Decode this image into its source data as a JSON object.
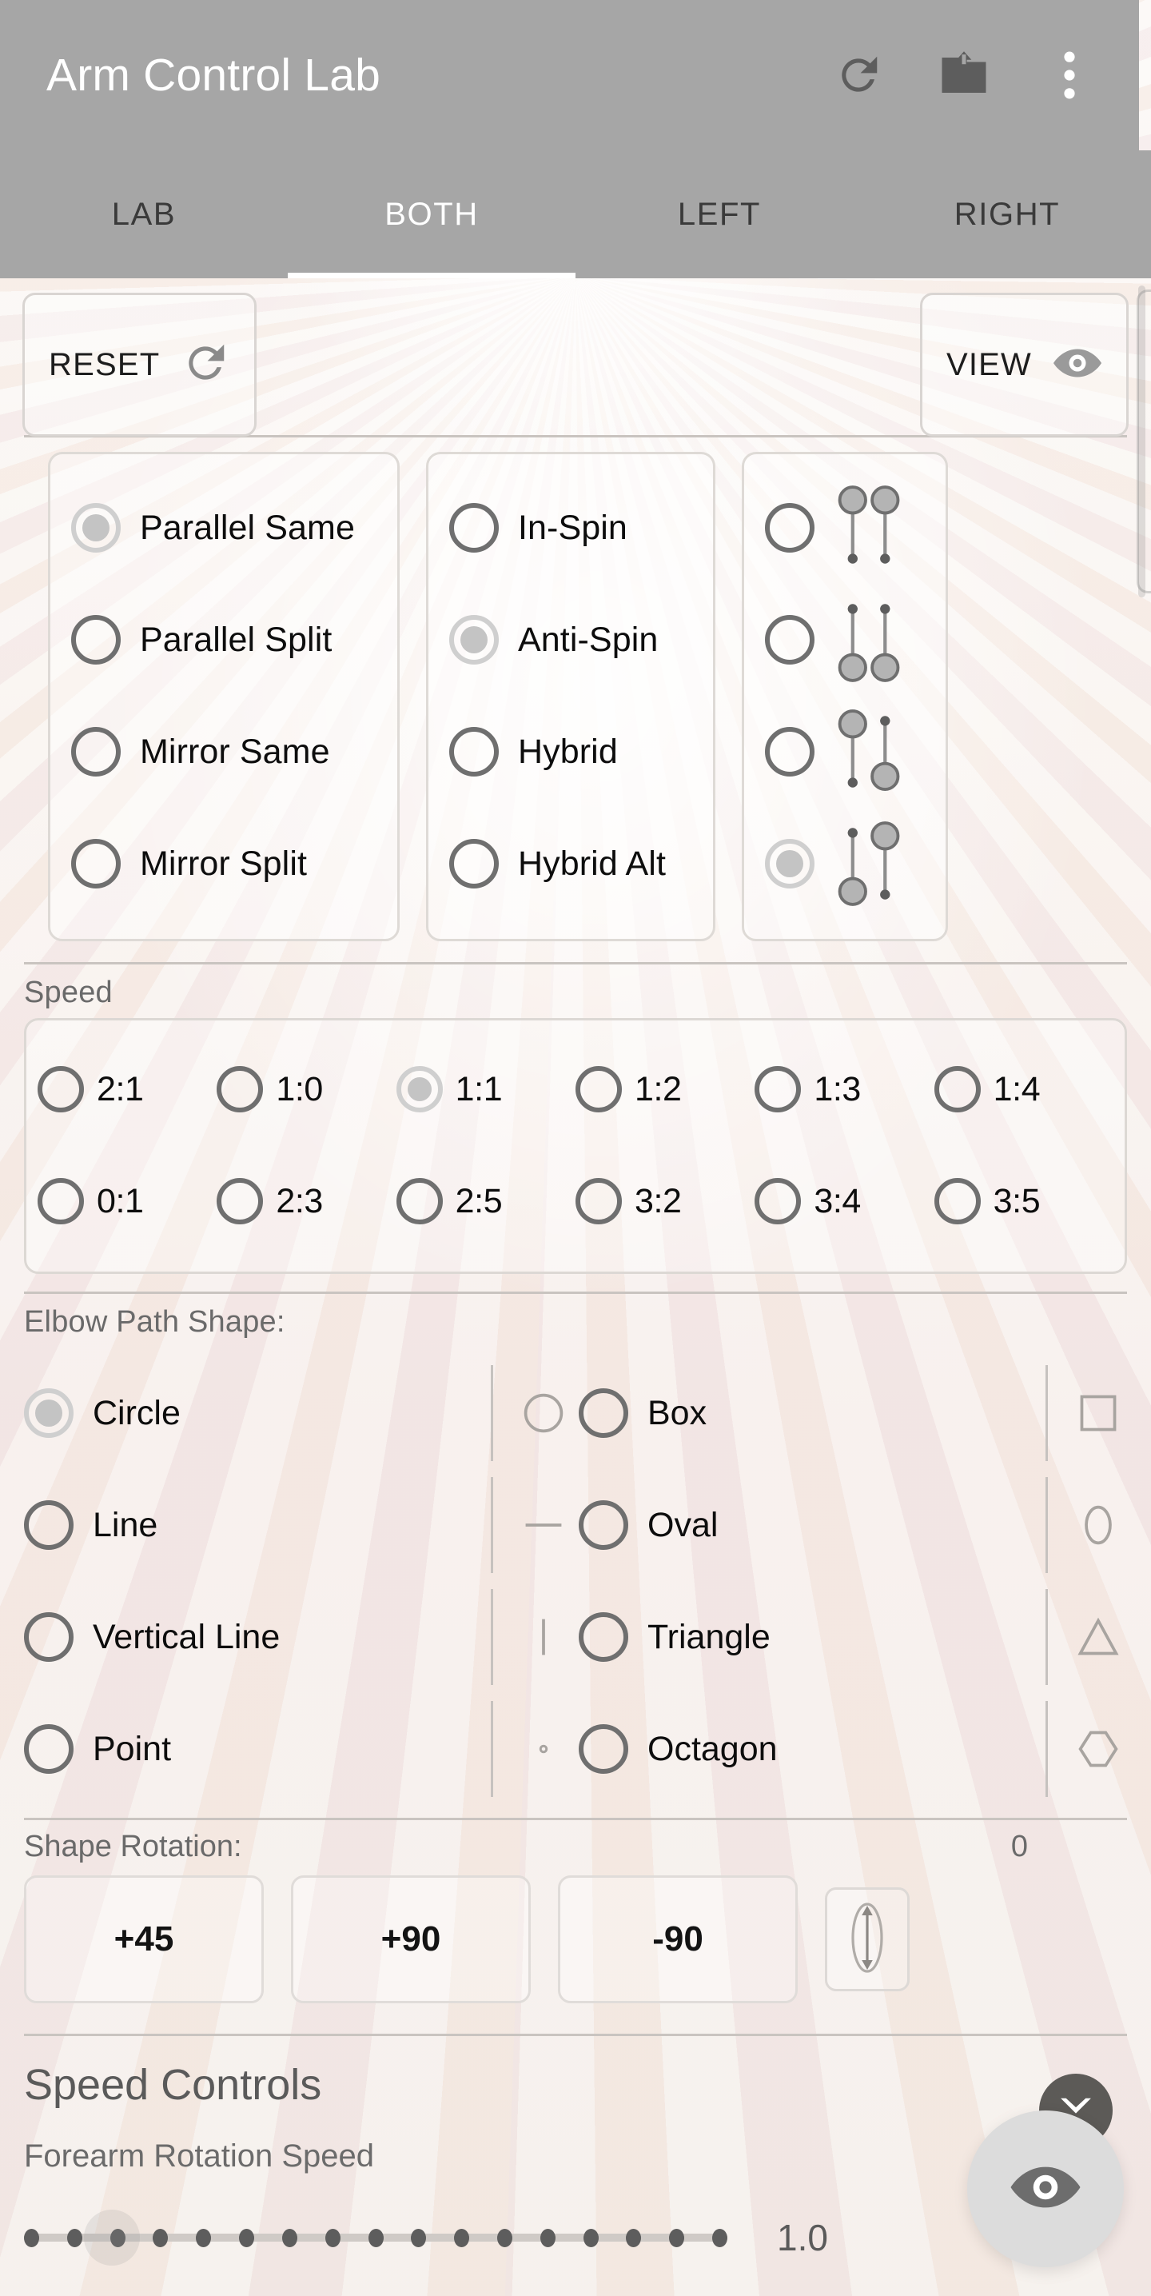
{
  "appbar": {
    "title": "Arm Control Lab",
    "icons": [
      {
        "name": "refresh-icon",
        "label": "Refresh"
      },
      {
        "name": "folder-upload-icon",
        "label": "Load"
      },
      {
        "name": "overflow-menu-icon",
        "label": "More options"
      }
    ]
  },
  "tabs": [
    {
      "label": "LAB",
      "selected": false
    },
    {
      "label": "BOTH",
      "selected": true
    },
    {
      "label": "LEFT",
      "selected": false
    },
    {
      "label": "RIGHT",
      "selected": false
    }
  ],
  "actions": {
    "reset_label": "RESET",
    "reset_icon": "refresh-icon",
    "view_label": "VIEW",
    "view_icon": "eye-icon"
  },
  "mode_groups": {
    "hand_pattern": {
      "options": [
        {
          "label": "Parallel Same",
          "selected": true
        },
        {
          "label": "Parallel Split",
          "selected": false
        },
        {
          "label": "Mirror Same",
          "selected": false
        },
        {
          "label": "Mirror Split",
          "selected": false
        }
      ]
    },
    "spin_mode": {
      "options": [
        {
          "label": "In-Spin",
          "selected": false
        },
        {
          "label": "Anti-Spin",
          "selected": true
        },
        {
          "label": "Hybrid",
          "selected": false
        },
        {
          "label": "Hybrid Alt",
          "selected": false
        }
      ]
    },
    "phase_mode": {
      "options": [
        {
          "icon": "pendulum-both-top-icon",
          "selected": false
        },
        {
          "icon": "pendulum-both-bottom-icon",
          "selected": false
        },
        {
          "icon": "pendulum-split-a-icon",
          "selected": false
        },
        {
          "icon": "pendulum-split-b-icon",
          "selected": true
        }
      ]
    }
  },
  "speed": {
    "title": "Speed",
    "rows": [
      [
        {
          "label": "2:1",
          "selected": false
        },
        {
          "label": "1:0",
          "selected": false
        },
        {
          "label": "1:1",
          "selected": true
        },
        {
          "label": "1:2",
          "selected": false
        },
        {
          "label": "1:3",
          "selected": false
        },
        {
          "label": "1:4",
          "selected": false
        }
      ],
      [
        {
          "label": "0:1",
          "selected": false
        },
        {
          "label": "2:3",
          "selected": false
        },
        {
          "label": "2:5",
          "selected": false
        },
        {
          "label": "3:2",
          "selected": false
        },
        {
          "label": "3:4",
          "selected": false
        },
        {
          "label": "3:5",
          "selected": false
        }
      ]
    ]
  },
  "elbow_path": {
    "title": "Elbow Path Shape:",
    "left_column": [
      {
        "label": "Circle",
        "shape": "circle",
        "selected": true
      },
      {
        "label": "Line",
        "shape": "line",
        "selected": false
      },
      {
        "label": "Vertical Line",
        "shape": "vertical-line",
        "selected": false
      },
      {
        "label": "Point",
        "shape": "point",
        "selected": false
      }
    ],
    "right_column": [
      {
        "label": "Box",
        "shape": "box",
        "selected": false
      },
      {
        "label": "Oval",
        "shape": "oval",
        "selected": false
      },
      {
        "label": "Triangle",
        "shape": "triangle",
        "selected": false
      },
      {
        "label": "Octagon",
        "shape": "octagon",
        "selected": false
      }
    ]
  },
  "shape_rotation": {
    "title": "Shape Rotation:",
    "value": "0",
    "buttons": [
      {
        "label": "+45"
      },
      {
        "label": "+90"
      },
      {
        "label": "-90"
      }
    ],
    "indicator_icon": "vertical-double-arrow-icon"
  },
  "speed_controls": {
    "title": "Speed Controls",
    "slider_label": "Forearm Rotation Speed",
    "slider_value": "1.0",
    "slider_ticks": 17,
    "slider_thumb_index": 2
  },
  "fab": {
    "icon": "eye-icon",
    "badge_icon": "chevron-down-icon"
  },
  "colors": {
    "appbar_bg": "#a6a6a6",
    "tab_selected_text": "#ffffff",
    "tab_text": "#3a3a3a",
    "radio_stroke": "#6f6f6f",
    "radio_selected": "#c4c4c4",
    "label_text": "#0d0d0d",
    "muted_text": "#6a6a6a",
    "fab_bg": "#dcdcdc",
    "badge_bg": "#5c5a57"
  }
}
